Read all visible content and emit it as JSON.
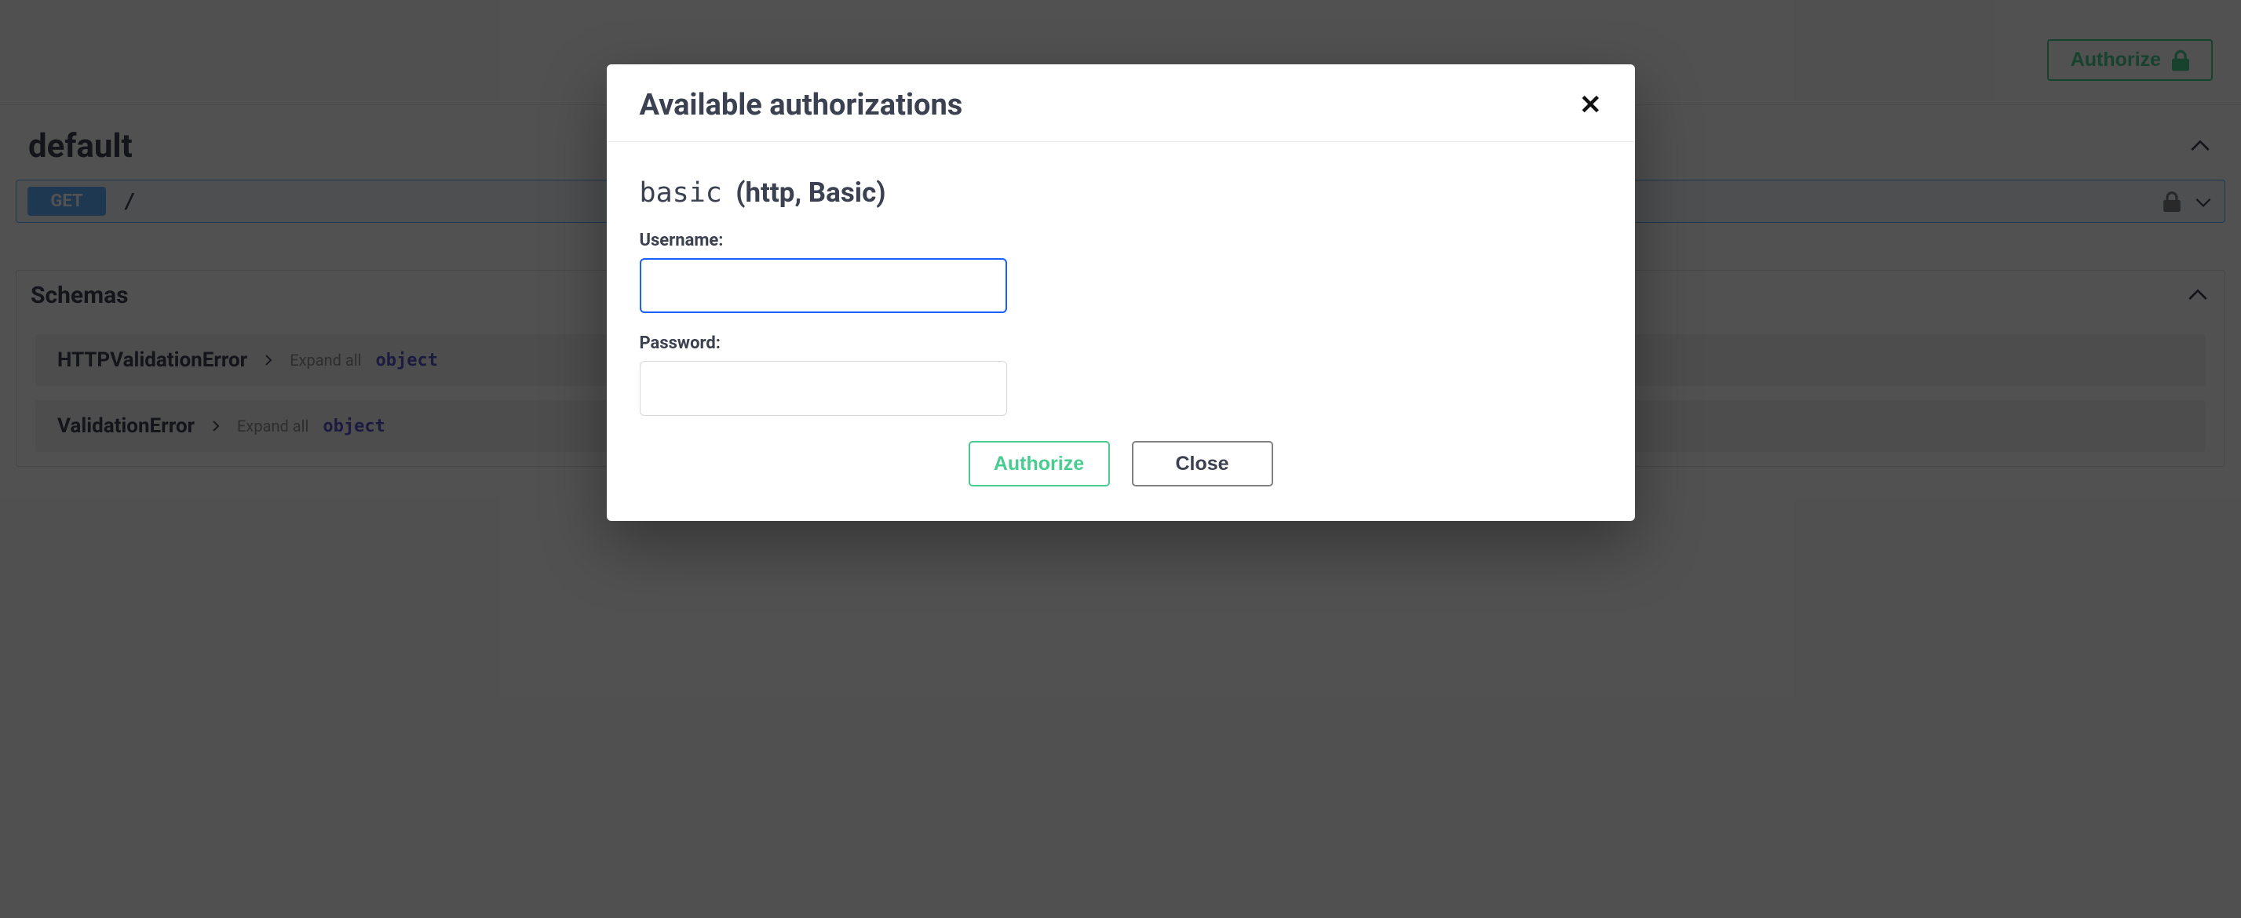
{
  "top": {
    "authorize_label": "Authorize"
  },
  "section": {
    "title": "default"
  },
  "operation": {
    "method": "GET",
    "path": "/"
  },
  "schemas": {
    "heading": "Schemas",
    "items": [
      {
        "name": "HTTPValidationError",
        "expand_label": "Expand all",
        "type": "object"
      },
      {
        "name": "ValidationError",
        "expand_label": "Expand all",
        "type": "object"
      }
    ]
  },
  "modal": {
    "title": "Available authorizations",
    "close_glyph": "✕",
    "scheme_name": "basic",
    "scheme_desc": "(http, Basic)",
    "username_label": "Username:",
    "username_value": "",
    "password_label": "Password:",
    "password_value": "",
    "authorize_label": "Authorize",
    "close_label": "Close"
  }
}
